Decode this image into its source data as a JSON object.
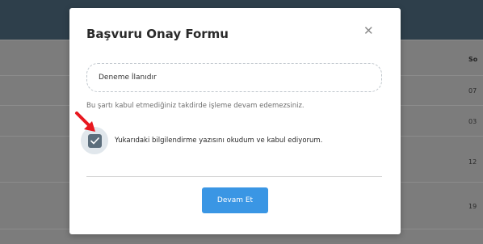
{
  "background": {
    "table_header": "So",
    "rows": [
      "07",
      "03",
      "12",
      "19"
    ]
  },
  "modal": {
    "title": "Başvuru Onay Formu",
    "close_symbol": "✕",
    "field_value": "Deneme İlanıdır",
    "hint": "Bu şartı kabul etmediğiniz takdirde işleme devam edemezsiniz.",
    "checkbox_label": "Yukarıdaki bilgilendirme yazısını okudum ve kabul ediyorum.",
    "checkbox_checked": true,
    "continue_button": "Devam Et"
  },
  "colors": {
    "header_bg": "#2e3f4b",
    "button_bg": "#3a96e4",
    "checkbox_bg": "#5c6e7c",
    "arrow": "#e8181f"
  },
  "icons": {
    "close": "close-icon",
    "check": "check-icon",
    "annotation_arrow": "red-arrow-icon"
  }
}
